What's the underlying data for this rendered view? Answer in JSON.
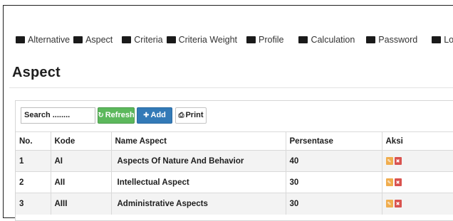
{
  "nav": {
    "items": [
      {
        "label": "Alternative",
        "icon": "menu-square-icon"
      },
      {
        "label": "Aspect",
        "icon": "menu-square-icon"
      },
      {
        "label": "Criteria",
        "icon": "menu-square-icon"
      },
      {
        "label": "Criteria Weight",
        "icon": "menu-square-icon"
      },
      {
        "label": "Profile",
        "icon": "menu-square-icon"
      },
      {
        "label": "Calculation",
        "icon": "menu-square-icon"
      },
      {
        "label": "Password",
        "icon": "menu-square-icon"
      },
      {
        "label": "Logout",
        "icon": "menu-square-icon"
      }
    ]
  },
  "page": {
    "title": "Aspect"
  },
  "toolbar": {
    "search_placeholder": "Search ........",
    "refresh_label": "Refresh",
    "add_label": "Add",
    "print_label": "Print"
  },
  "table": {
    "headers": [
      "No.",
      "Kode",
      "Name Aspect",
      "Persentase",
      "Aksi"
    ],
    "rows": [
      {
        "no": "1",
        "kode": "AI",
        "name": "Aspects Of Nature And Behavior",
        "persentase": "40"
      },
      {
        "no": "2",
        "kode": "AII",
        "name": "Intellectual Aspect",
        "persentase": "30"
      },
      {
        "no": "3",
        "kode": "AIII",
        "name": "Administrative Aspects",
        "persentase": "30"
      }
    ]
  },
  "colors": {
    "refresh": "#5cb85c",
    "add": "#337ab7",
    "edit": "#f0ad4e",
    "delete": "#d9534f"
  }
}
